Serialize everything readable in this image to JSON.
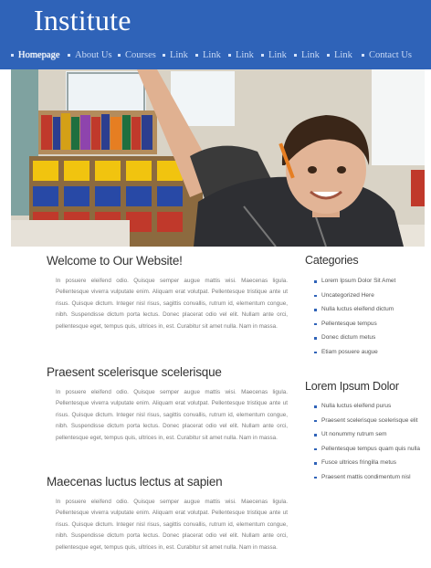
{
  "site": {
    "title": "Institute"
  },
  "nav": [
    {
      "label": "Homepage"
    },
    {
      "label": "About Us"
    },
    {
      "label": "Courses"
    },
    {
      "label": "Link"
    },
    {
      "label": "Link"
    },
    {
      "label": "Link"
    },
    {
      "label": "Link"
    },
    {
      "label": "Link"
    },
    {
      "label": "Link"
    },
    {
      "label": "Contact Us"
    }
  ],
  "posts": [
    {
      "title": "Welcome to Our Website!",
      "body": "In posuere eleifend odio. Quisque semper augue mattis wisi. Maecenas ligula. Pellentesque viverra vulputate enim. Aliquam erat volutpat. Pellentesque tristique ante ut risus. Quisque dictum. Integer nisl risus, sagittis convallis, rutrum id, elementum congue, nibh. Suspendisse dictum porta lectus. Donec placerat odio vel elit. Nullam ante orci, pellentesque eget, tempus quis, ultrices in, est. Curabitur sit amet nulla. Nam in massa."
    },
    {
      "title": "Praesent scelerisque scelerisque",
      "body": "In posuere eleifend odio. Quisque semper augue mattis wisi. Maecenas ligula. Pellentesque viverra vulputate enim. Aliquam erat volutpat. Pellentesque tristique ante ut risus. Quisque dictum. Integer nisl risus, sagittis convallis, rutrum id, elementum congue, nibh. Suspendisse dictum porta lectus. Donec placerat odio vel elit. Nullam ante orci, pellentesque eget, tempus quis, ultrices in, est. Curabitur sit amet nulla. Nam in massa."
    },
    {
      "title": "Maecenas luctus lectus at sapien",
      "body": "In posuere eleifend odio. Quisque semper augue mattis wisi. Maecenas ligula. Pellentesque viverra vulputate enim. Aliquam erat volutpat. Pellentesque tristique ante ut risus. Quisque dictum. Integer nisl risus, sagittis convallis, rutrum id, elementum congue, nibh. Suspendisse dictum porta lectus. Donec placerat odio vel elit. Nullam ante orci, pellentesque eget, tempus quis, ultrices in, est. Curabitur sit amet nulla. Nam in massa."
    }
  ],
  "sidebar": {
    "categories": {
      "title": "Categories",
      "items": [
        "Lorem Ipsum Dolor Sit Amet",
        "Uncategorized Here",
        "Nulla luctus eleifend dictum",
        "Pellentesque tempus",
        "Donec dictum metus",
        "Etiam posuere augue"
      ]
    },
    "lorem": {
      "title": "Lorem Ipsum Dolor",
      "items": [
        "Nulla luctus eleifend purus",
        "Praesent scelerisque scelerisque elit",
        "Ut nonummy rutrum sem",
        "Pellentesque tempus quam quis nulla",
        "Fusce ultrices fringilla metus",
        "Praesent mattis condimentum nisl"
      ]
    }
  },
  "colors": {
    "header": "#2f63b8",
    "text": "#333333",
    "body_text": "#7a7a7a"
  }
}
